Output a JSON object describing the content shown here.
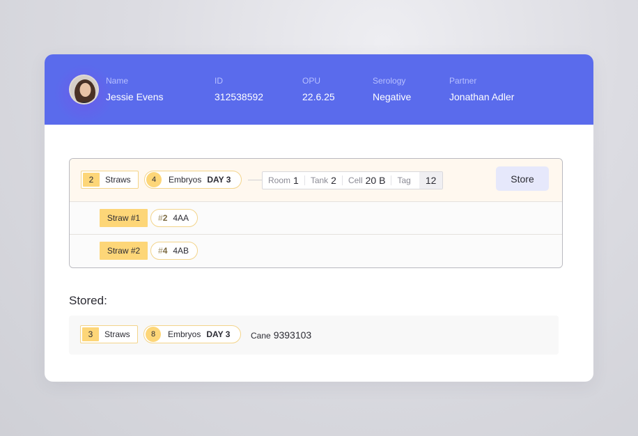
{
  "patient": {
    "name_label": "Name",
    "name": "Jessie Evens",
    "id_label": "ID",
    "id": "312538592",
    "opu_label": "OPU",
    "opu": "22.6.25",
    "serology_label": "Serology",
    "serology": "Negative",
    "partner_label": "Partner",
    "partner": "Jonathan Adler"
  },
  "current_batch": {
    "straws_count": "2",
    "straws_label": "Straws",
    "embryos_count": "4",
    "embryos_label": "Embryos",
    "day": "DAY 3",
    "room_label": "Room",
    "room": "1",
    "tank_label": "Tank",
    "tank": "2",
    "cell_label": "Cell",
    "cell": "20 B",
    "tag_label": "Tag",
    "tag": "12",
    "store_button": "Store",
    "straws": [
      {
        "label": "Straw #1",
        "hash": "#",
        "embryo_num": "2",
        "grade": "4AA"
      },
      {
        "label": "Straw #2",
        "hash": "#",
        "embryo_num": "4",
        "grade": "4AB"
      }
    ]
  },
  "stored": {
    "title": "Stored:",
    "straws_count": "3",
    "straws_label": "Straws",
    "embryos_count": "8",
    "embryos_label": "Embryos",
    "day": "DAY 3",
    "cane_label": "Cane",
    "cane": "9393103"
  },
  "colors": {
    "header_bg": "#5a6bec",
    "badge_yellow": "#fdd678",
    "store_button_bg": "#e6e8fb",
    "batch_bg": "#fff8ef"
  }
}
